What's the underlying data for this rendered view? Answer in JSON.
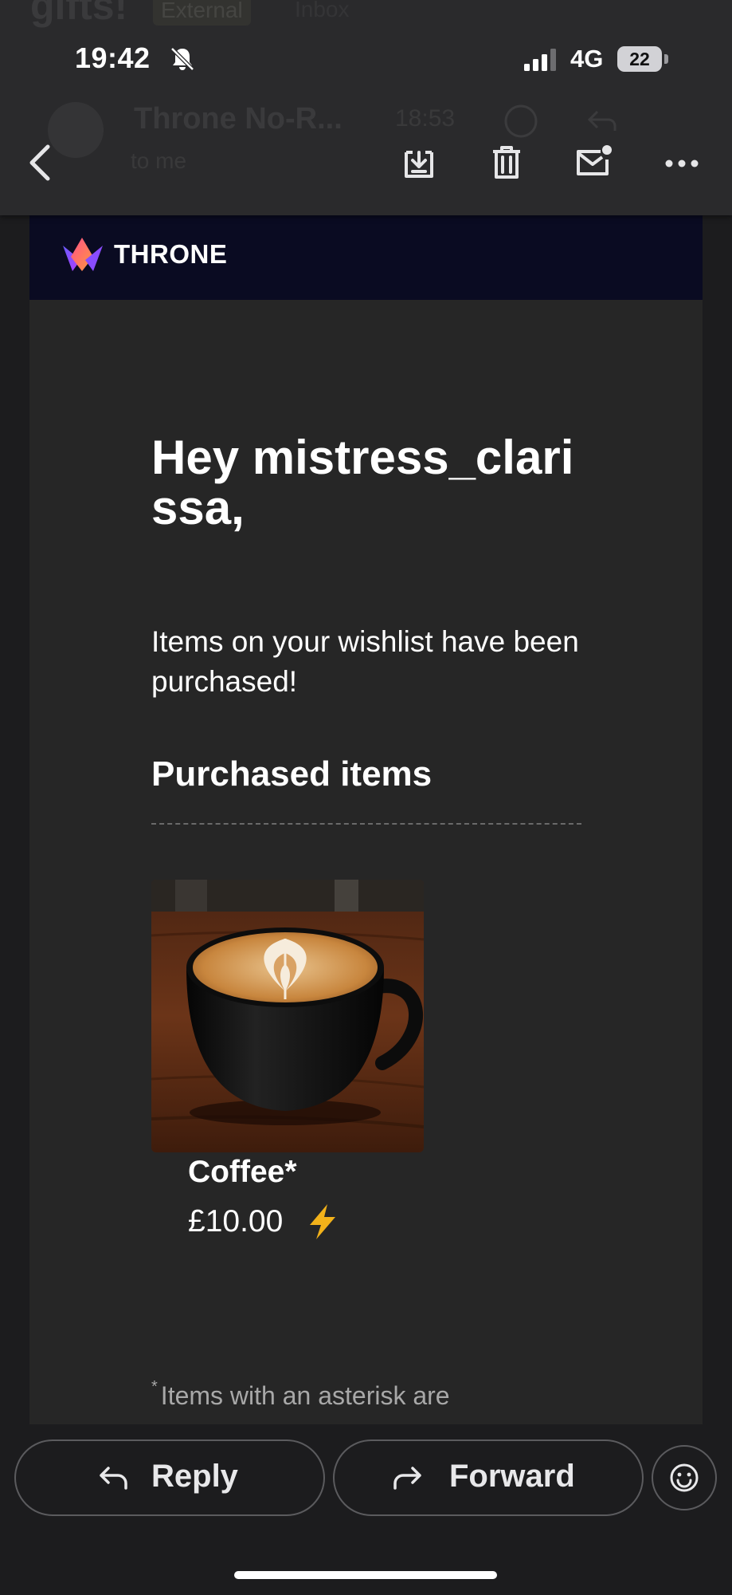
{
  "background_subject": {
    "title": "gifts!",
    "badge": "External",
    "extra": "Inbox",
    "sender": "Throne No-R...",
    "time": "18:53",
    "recipient": "to me"
  },
  "status_bar": {
    "time": "19:42",
    "network": "4G",
    "battery": "22"
  },
  "toolbar": {
    "icons": [
      "back-icon",
      "archive-icon",
      "trash-icon",
      "mark-unread-icon",
      "more-icon"
    ]
  },
  "email": {
    "brand": "THRONE",
    "greeting": "Hey mistress_clarissa,",
    "intro": "Items on your wishlist have been purchased!",
    "section_title": "Purchased items",
    "items": [
      {
        "name": "Coffee*",
        "price": "£10.00",
        "icon": "lightning-bolt-icon"
      }
    ],
    "footnote_marker": "*",
    "footnote": "Items with an asterisk are"
  },
  "actions": {
    "reply_label": "Reply",
    "forward_label": "Forward",
    "emoji_icon": "smiley-icon"
  },
  "colors": {
    "brand_header": "#0a0b22",
    "email_background": "#262626",
    "app_background": "#1c1c1e",
    "bolt": "#f2b21a"
  }
}
